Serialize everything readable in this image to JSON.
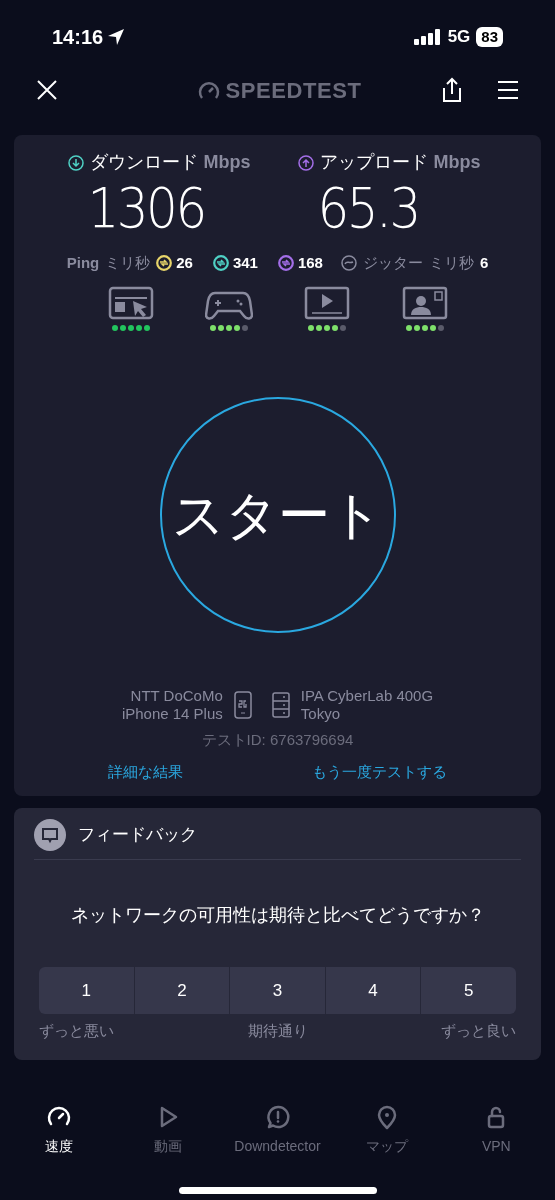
{
  "status_bar": {
    "time": "14:16",
    "network": "5G",
    "battery": "83"
  },
  "header": {
    "title": "SPEEDTEST"
  },
  "results": [
    {
      "kind": "download",
      "label": "ダウンロード",
      "unit": "Mbps",
      "value": "1306"
    },
    {
      "kind": "upload",
      "label": "アップロード",
      "unit": "Mbps",
      "value": "65.3"
    }
  ],
  "ping": {
    "label": "Ping",
    "unit": "ミリ秒",
    "readings": [
      {
        "value": "26",
        "color": "#e8d56a"
      },
      {
        "value": "341",
        "color": "#4fd1c5"
      },
      {
        "value": "168",
        "color": "#a36ee8"
      }
    ]
  },
  "jitter": {
    "label": "ジッター",
    "unit": "ミリ秒",
    "value": "6"
  },
  "quality": [
    {
      "kind": "browsing",
      "stars": 5
    },
    {
      "kind": "gaming",
      "stars": 4
    },
    {
      "kind": "video",
      "stars": 4
    },
    {
      "kind": "video_call",
      "stars": 4
    }
  ],
  "start_button": "スタート",
  "connection": {
    "provider": "NTT DoCoMo",
    "device": "iPhone 14 Plus",
    "server": "IPA CyberLab 400G",
    "location": "Tokyo",
    "test_id": "テストID: 6763796694"
  },
  "links": [
    "詳細な結果",
    "もう一度テストする"
  ],
  "feedback": {
    "title": "フィードバック",
    "question": "ネットワークの可用性は期待と比べてどうですか？",
    "options": [
      "1",
      "2",
      "3",
      "4",
      "5"
    ],
    "scale_labels": [
      "ずっと悪い",
      "期待通り",
      "ずっと良い"
    ]
  },
  "tab_bar": [
    {
      "kind": "speed",
      "label": "速度",
      "selected": true
    },
    {
      "kind": "video",
      "label": "動画",
      "selected": false
    },
    {
      "kind": "alert",
      "label": "Downdetector",
      "selected": false
    },
    {
      "kind": "map",
      "label": "マップ",
      "selected": false
    },
    {
      "kind": "vpn",
      "label": "VPN",
      "selected": false
    }
  ]
}
